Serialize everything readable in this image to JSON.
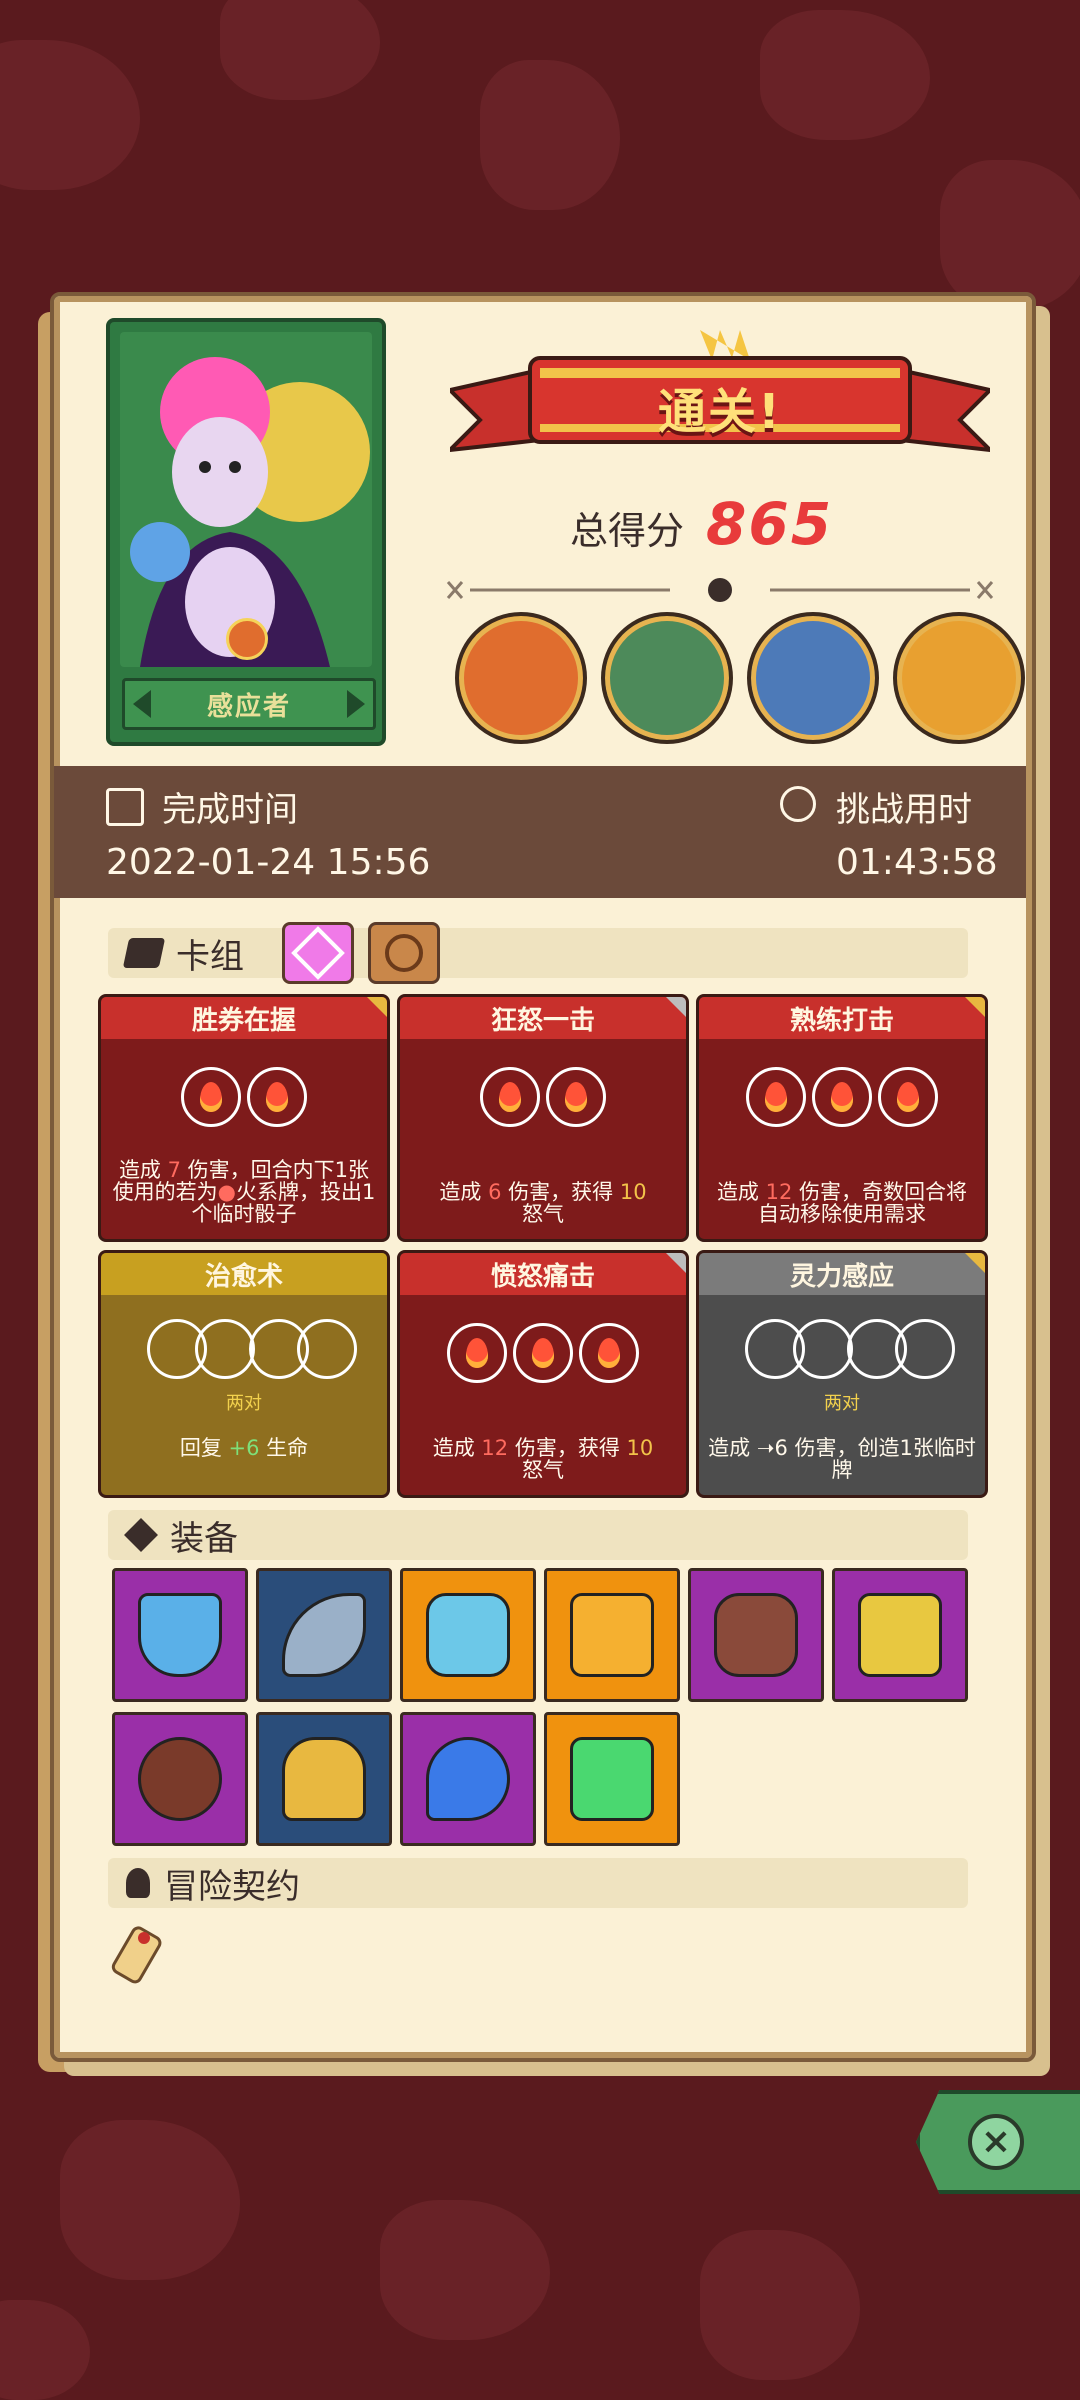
{
  "hero": {
    "name": "感应者"
  },
  "result": {
    "banner": "通关!",
    "score_label": "总得分",
    "score": "865"
  },
  "bosses": [
    "cyclops-boss-icon",
    "orc-boss-icon",
    "fish-boss-icon",
    "fire-demon-boss-icon"
  ],
  "time": {
    "complete_label": "完成时间",
    "complete_value": "2022-01-24 15:56",
    "challenge_label": "挑战用时",
    "challenge_value": "01:43:58"
  },
  "deck": {
    "title": "卡组",
    "cards": [
      {
        "title": "胜券在握",
        "color": "red",
        "energy": 2,
        "desc_pre": "造成 ",
        "dmg": "7",
        "desc_post": " 伤害，回合内下1张使用的若为",
        "desc_extra": "火系牌，投出1个临时骰子"
      },
      {
        "title": "狂怒一击",
        "color": "red",
        "energy": 2,
        "desc_pre": "造成 ",
        "dmg": "6",
        "desc_post": " 伤害，获得 ",
        "rage": "10",
        "desc_extra": "怒气"
      },
      {
        "title": "熟练打击",
        "color": "red",
        "energy": 3,
        "desc_pre": "造成 ",
        "dmg": "12",
        "desc_post": " 伤害，奇数回合将自动移除使用需求"
      },
      {
        "title": "治愈术",
        "color": "gold",
        "pair_label": "两对",
        "desc_pre": "回复 ",
        "heal": "+6",
        "desc_post": " 生命"
      },
      {
        "title": "愤怒痛击",
        "color": "red",
        "energy": 3,
        "desc_pre": "造成 ",
        "dmg": "12",
        "desc_post": " 伤害，获得 ",
        "rage": "10",
        "desc_extra": "怒气"
      },
      {
        "title": "灵力感应",
        "color": "gray",
        "pair_label": "两对",
        "desc_pre": "造成 ",
        "dmg_plain": "6",
        "desc_post": " 伤害，创造1张临时牌"
      }
    ]
  },
  "equipment": {
    "title": "装备",
    "items": [
      {
        "icon": "shield-icon",
        "bg": "purple"
      },
      {
        "icon": "scythe-icon",
        "bg": "navy"
      },
      {
        "icon": "crystal-shield-icon",
        "bg": "orange"
      },
      {
        "icon": "sweater-icon",
        "bg": "orange"
      },
      {
        "icon": "fire-stone-icon",
        "bg": "purple"
      },
      {
        "icon": "golden-die-icon",
        "bg": "purple"
      },
      {
        "icon": "button-icon",
        "bg": "purple"
      },
      {
        "icon": "golden-helmet-icon",
        "bg": "navy"
      },
      {
        "icon": "blue-flame-icon",
        "bg": "purple"
      },
      {
        "icon": "green-die-icon",
        "bg": "orange"
      }
    ]
  },
  "contract": {
    "title": "冒险契约"
  }
}
